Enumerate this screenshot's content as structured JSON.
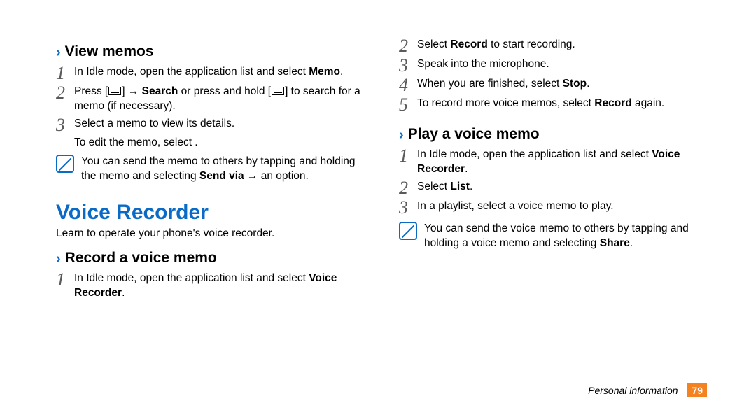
{
  "left": {
    "heading_view": "View memos",
    "view_steps": {
      "s1_a": "In Idle mode, open the application list and select ",
      "s1_b": "Memo",
      "s1_c": ".",
      "s2_a": "Press [",
      "s2_b": "] → ",
      "s2_c": "Search",
      "s2_d": " or press and hold [",
      "s2_e": "] to search for a memo (if necessary).",
      "s3": "Select a memo to view its details.",
      "s3_sub": "To edit the memo, select       ."
    },
    "note1_a": "You can send the memo to others by tapping and holding the memo and selecting ",
    "note1_b": "Send via",
    "note1_c": " → an option.",
    "section_title": "Voice Recorder",
    "intro": "Learn to operate your phone's voice recorder.",
    "heading_record": "Record a voice memo",
    "record_steps": {
      "s1_a": "In Idle mode, open the application list and select ",
      "s1_b": "Voice Recorder",
      "s1_c": "."
    }
  },
  "right": {
    "cont_steps": {
      "s2_a": "Select ",
      "s2_b": "Record",
      "s2_c": " to start recording.",
      "s3": "Speak into the microphone.",
      "s4_a": "When you are finished, select ",
      "s4_b": "Stop",
      "s4_c": ".",
      "s5_a": "To record more voice memos, select ",
      "s5_b": "Record",
      "s5_c": " again."
    },
    "heading_play": "Play a voice memo",
    "play_steps": {
      "s1_a": "In Idle mode, open the application list and select ",
      "s1_b": "Voice Recorder",
      "s1_c": ".",
      "s2_a": "Select ",
      "s2_b": "List",
      "s2_c": ".",
      "s3": "In a playlist, select a voice memo to play."
    },
    "note2_a": "You can send the voice memo to others by tapping and holding a voice memo and selecting ",
    "note2_b": "Share",
    "note2_c": "."
  },
  "footer": {
    "label": "Personal information",
    "page": "79"
  }
}
